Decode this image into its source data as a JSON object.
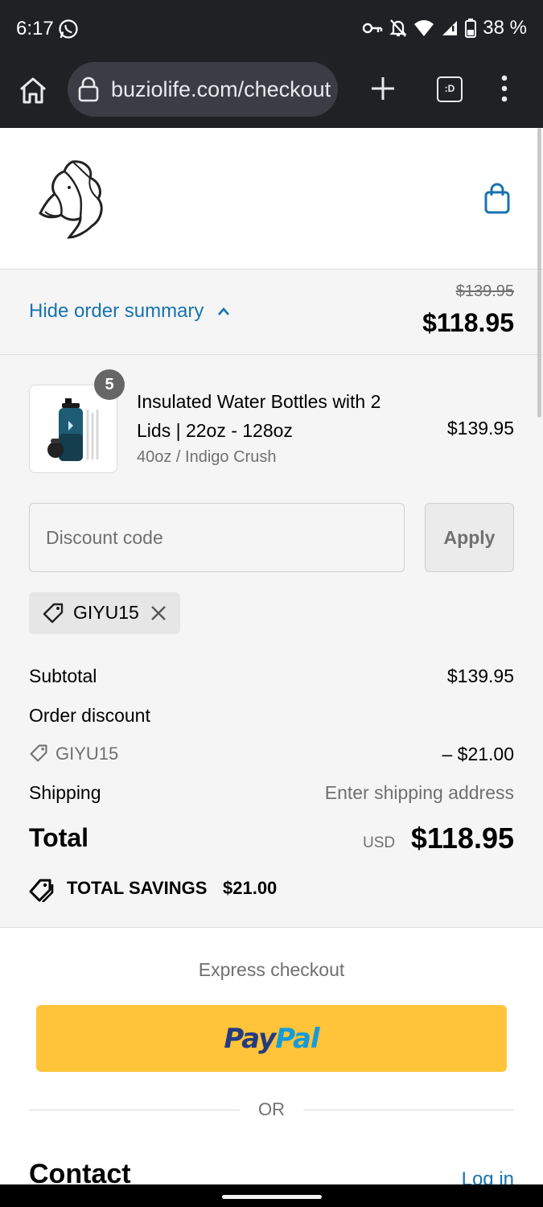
{
  "status_bar": {
    "time": "6:17",
    "battery": "38 %"
  },
  "browser": {
    "url": "buziolife.com/checkout",
    "tabs_label": ":D"
  },
  "order_summary": {
    "toggle_label": "Hide order summary",
    "original_total": "$139.95",
    "discounted_total": "$118.95"
  },
  "product": {
    "quantity": "5",
    "name": "Insulated Water Bottles with 2 Lids | 22oz - 128oz",
    "variant": "40oz / Indigo Crush",
    "price": "$139.95"
  },
  "discount": {
    "placeholder": "Discount code",
    "apply_label": "Apply",
    "applied_code": "GIYU15"
  },
  "totals": {
    "subtotal_label": "Subtotal",
    "subtotal_value": "$139.95",
    "order_discount_label": "Order discount",
    "discount_code": "GIYU15",
    "discount_value": "– $21.00",
    "shipping_label": "Shipping",
    "shipping_value": "Enter shipping address",
    "total_label": "Total",
    "currency": "USD",
    "total_value": "$118.95",
    "savings_label": "TOTAL SAVINGS",
    "savings_value": "$21.00"
  },
  "express": {
    "title": "Express checkout",
    "paypal_part1": "Pay",
    "paypal_part2": "Pal",
    "or_label": "OR"
  },
  "contact": {
    "heading": "Contact",
    "login_label": "Log in"
  },
  "colors": {
    "link": "#1773b0",
    "paypal_yellow": "#ffc439",
    "muted": "#707070"
  }
}
